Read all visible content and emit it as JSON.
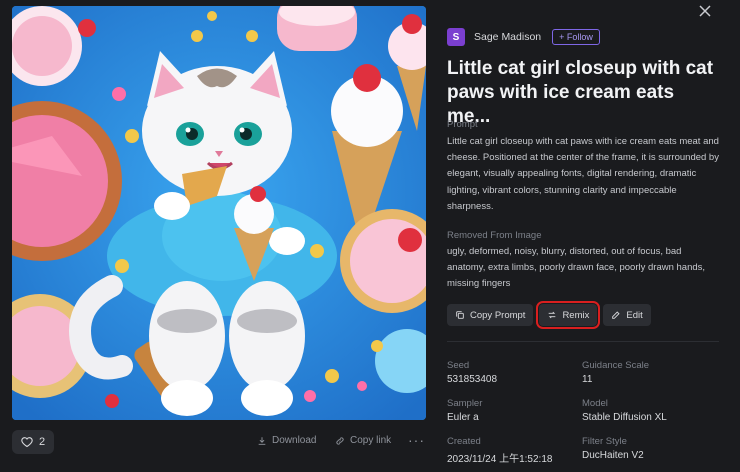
{
  "image": {
    "alt": "Little cat girl closeup with cat paws with ice cream",
    "palette": {
      "bg": "#2b8ee0",
      "cat": "#f4f4f6",
      "dress": "#41b6ea",
      "pink": "#f2a7c2",
      "cone": "#d6a15a",
      "pie": "#c46e3c"
    }
  },
  "image_actions": {
    "like_count": "2",
    "download_label": "Download",
    "copy_link_label": "Copy link",
    "more_label": "···"
  },
  "author": {
    "avatar_letter": "S",
    "name": "Sage Madison",
    "follow_label": "+ Follow",
    "avatar_color": "#7b3fd0"
  },
  "title": "Little cat girl closeup with cat paws with ice cream eats me...",
  "prompt": {
    "label": "Prompt",
    "text": "Little cat girl closeup with cat paws with ice cream eats meat and cheese. Positioned at the center of the frame, it is surrounded by elegant, visually appealing fonts, digital rendering, dramatic lighting, vibrant colors, stunning clarity and impeccable sharpness."
  },
  "negative": {
    "label": "Removed From Image",
    "text": "ugly, deformed, noisy, blurry, distorted, out of focus, bad anatomy, extra limbs, poorly drawn face, poorly drawn hands, missing fingers"
  },
  "buttons": {
    "copy_prompt": "Copy Prompt",
    "remix": "Remix",
    "edit": "Edit",
    "highlight_color": "#d91f1f"
  },
  "meta": {
    "seed_label": "Seed",
    "seed_value": "531853408",
    "guidance_label": "Guidance Scale",
    "guidance_value": "11",
    "sampler_label": "Sampler",
    "sampler_value": "Euler a",
    "model_label": "Model",
    "model_value": "Stable Diffusion XL",
    "created_label": "Created",
    "created_value": "2023/11/24 上午1:52:18",
    "filter_label": "Filter Style",
    "filter_value": "DucHaiten V2"
  }
}
